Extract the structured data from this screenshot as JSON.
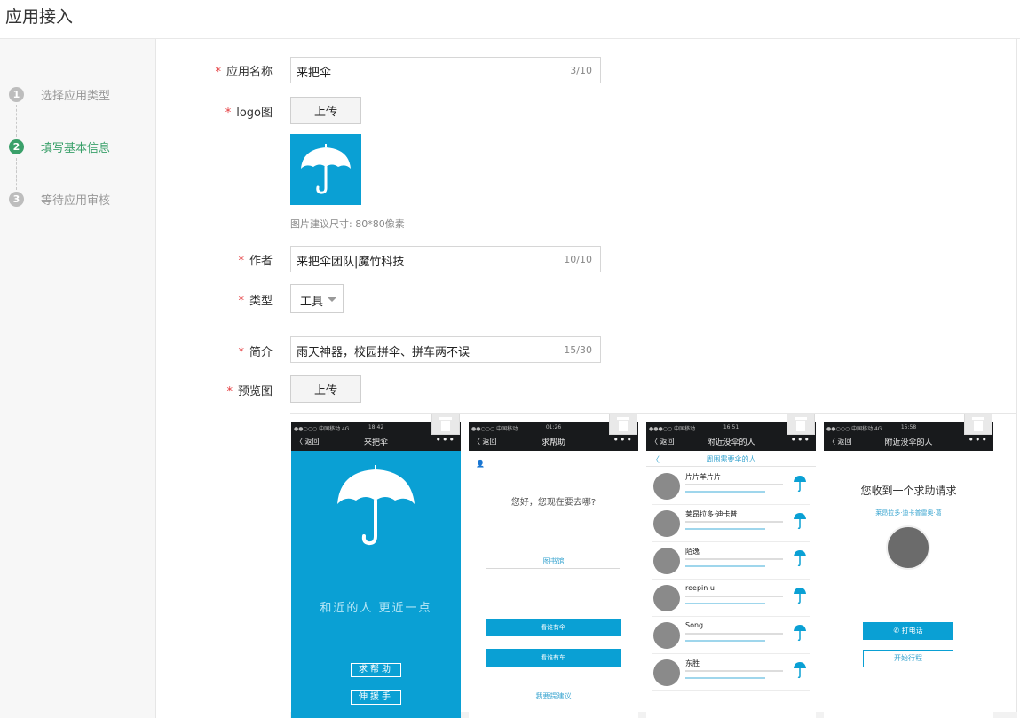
{
  "header": {
    "title": "应用接入"
  },
  "steps": [
    {
      "num": "1",
      "label": "选择应用类型"
    },
    {
      "num": "2",
      "label": "填写基本信息"
    },
    {
      "num": "3",
      "label": "等待应用审核"
    }
  ],
  "form": {
    "app_name": {
      "label": "应用名称",
      "value": "来把伞",
      "counter": "3/10"
    },
    "logo": {
      "label": "logo图",
      "upload_label": "上传",
      "hint": "图片建议尺寸: 80*80像素"
    },
    "author": {
      "label": "作者",
      "value": "来把伞团队|魔竹科技",
      "counter": "10/10"
    },
    "type": {
      "label": "类型",
      "value": "工具"
    },
    "intro": {
      "label": "简介",
      "value": "雨天神器，校园拼伞、拼车两不误",
      "counter": "15/30"
    },
    "preview": {
      "label": "预览图",
      "upload_label": "上传"
    }
  },
  "previews": [
    {
      "status_carrier": "●●○○○ 中国移动 4G",
      "status_time": "18:42",
      "nav_back": "〈 返回",
      "nav_title": "来把伞",
      "slogan": "和近的人 更近一点",
      "buttons": [
        "求帮助",
        "伸援手"
      ]
    },
    {
      "status_carrier": "●●○○○ 中国移动",
      "status_time": "01:26",
      "nav_back": "〈 返回",
      "nav_title": "求帮助",
      "question": "您好，您现在要去哪?",
      "placeholder": "图书馆",
      "buttons": [
        "看谁有伞",
        "看谁有车"
      ],
      "link": "我要提建议"
    },
    {
      "status_carrier": "●●●○○ 中国移动",
      "status_time": "16:51",
      "nav_back": "〈 返回",
      "nav_title": "附近没伞的人",
      "subheader": "周围需要伞的人",
      "people": [
        "片片羊片片",
        "莱昂拉多·迪卡普",
        "陌逸",
        "reepin u",
        "Song",
        "东胜"
      ]
    },
    {
      "status_carrier": "●●○○○ 中国移动 4G",
      "status_time": "15:58",
      "nav_back": "〈 返回",
      "nav_title": "附近没伞的人",
      "message": "您收到一个求助请求",
      "sender": "莱昂拉多·迪卡普雷奥·葛",
      "buttons": [
        "打电话",
        "开始行程"
      ]
    }
  ],
  "colors": {
    "accent": "#3aa06a",
    "brand": "#0aa0d4",
    "required": "#e4393c"
  }
}
